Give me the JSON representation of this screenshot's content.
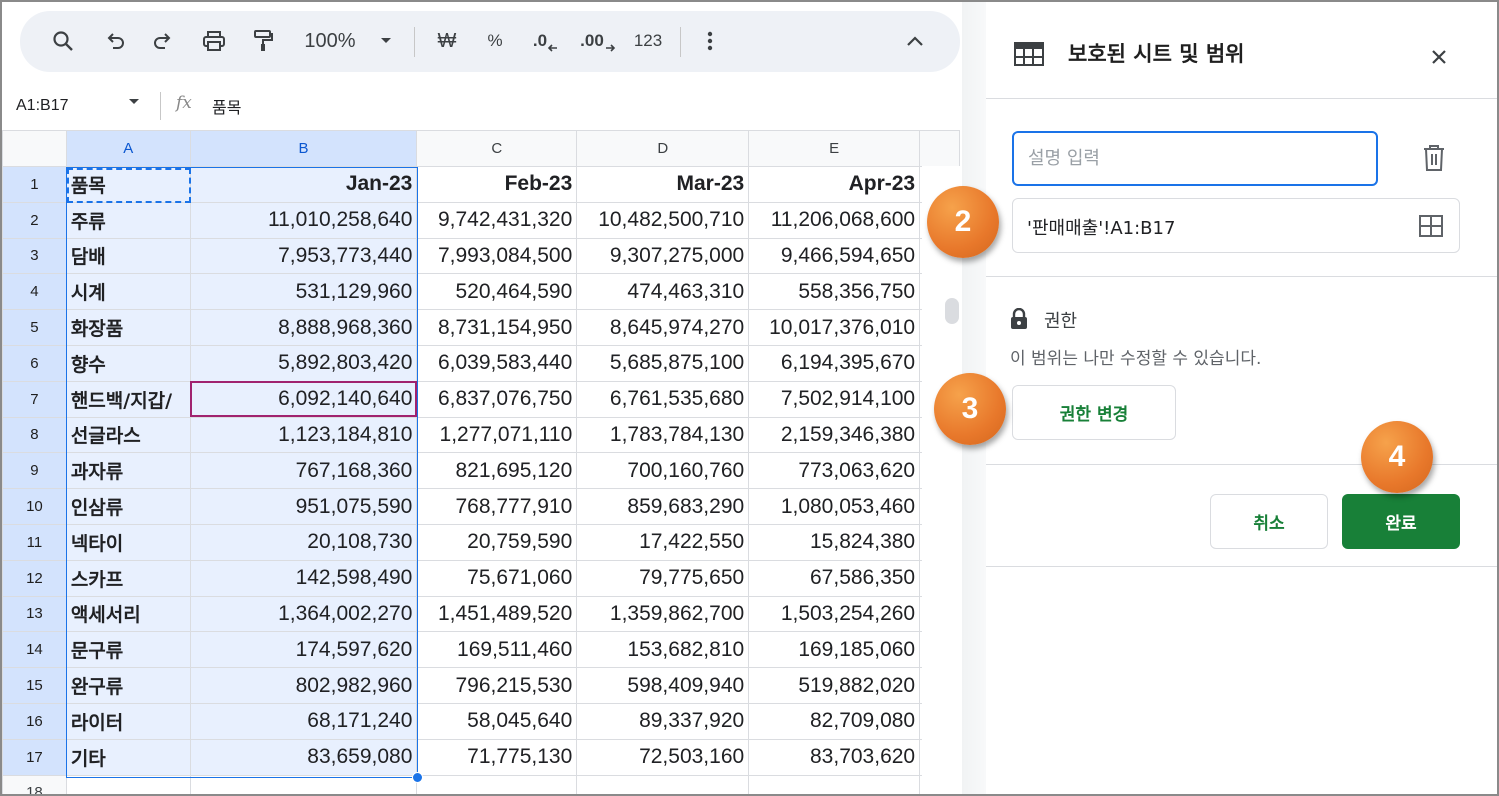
{
  "toolbar": {
    "zoom": "100%",
    "currency_symbol": "₩",
    "percent_symbol": "%",
    "decimal_decrease": ".0",
    "decimal_increase": ".00",
    "number_format": "123"
  },
  "formula_bar": {
    "name_box": "A1:B17",
    "fx": "fx",
    "content": "품목"
  },
  "sheet": {
    "columns": [
      "A",
      "B",
      "C",
      "D",
      "E"
    ],
    "rows": [
      {
        "n": "1",
        "cells": [
          "품목",
          "Jan-23",
          "Feb-23",
          "Mar-23",
          "Apr-23"
        ]
      },
      {
        "n": "2",
        "cells": [
          "주류",
          "11,010,258,640",
          "9,742,431,320",
          "10,482,500,710",
          "11,206,068,600"
        ]
      },
      {
        "n": "3",
        "cells": [
          "담배",
          "7,953,773,440",
          "7,993,084,500",
          "9,307,275,000",
          "9,466,594,650"
        ]
      },
      {
        "n": "4",
        "cells": [
          "시계",
          "531,129,960",
          "520,464,590",
          "474,463,310",
          "558,356,750"
        ]
      },
      {
        "n": "5",
        "cells": [
          "화장품",
          "8,888,968,360",
          "8,731,154,950",
          "8,645,974,270",
          "10,017,376,010"
        ]
      },
      {
        "n": "6",
        "cells": [
          "향수",
          "5,892,803,420",
          "6,039,583,440",
          "5,685,875,100",
          "6,194,395,670"
        ]
      },
      {
        "n": "7",
        "cells": [
          "핸드백/지갑/",
          "6,092,140,640",
          "6,837,076,750",
          "6,761,535,680",
          "7,502,914,100"
        ]
      },
      {
        "n": "8",
        "cells": [
          "선글라스",
          "1,123,184,810",
          "1,277,071,110",
          "1,783,784,130",
          "2,159,346,380"
        ]
      },
      {
        "n": "9",
        "cells": [
          "과자류",
          "767,168,360",
          "821,695,120",
          "700,160,760",
          "773,063,620"
        ]
      },
      {
        "n": "10",
        "cells": [
          "인삼류",
          "951,075,590",
          "768,777,910",
          "859,683,290",
          "1,080,053,460"
        ]
      },
      {
        "n": "11",
        "cells": [
          "넥타이",
          "20,108,730",
          "20,759,590",
          "17,422,550",
          "15,824,380"
        ]
      },
      {
        "n": "12",
        "cells": [
          "스카프",
          "142,598,490",
          "75,671,060",
          "79,775,650",
          "67,586,350"
        ]
      },
      {
        "n": "13",
        "cells": [
          "액세서리",
          "1,364,002,270",
          "1,451,489,520",
          "1,359,862,700",
          "1,503,254,260"
        ]
      },
      {
        "n": "14",
        "cells": [
          "문구류",
          "174,597,620",
          "169,511,460",
          "153,682,810",
          "169,185,060"
        ]
      },
      {
        "n": "15",
        "cells": [
          "완구류",
          "802,982,960",
          "796,215,530",
          "598,409,940",
          "519,882,020"
        ]
      },
      {
        "n": "16",
        "cells": [
          "라이터",
          "68,171,240",
          "58,045,640",
          "89,337,920",
          "82,709,080"
        ]
      },
      {
        "n": "17",
        "cells": [
          "기타",
          "83,659,080",
          "71,775,130",
          "72,503,160",
          "83,703,620"
        ]
      },
      {
        "n": "18",
        "cells": [
          "",
          "",
          "",
          "",
          ""
        ]
      }
    ]
  },
  "panel": {
    "title": "보호된 시트 및 범위",
    "description_placeholder": "설명 입력",
    "range": "'판매매출'!A1:B17",
    "permission_title": "권한",
    "permission_desc": "이 범위는 나만 수정할 수 있습니다.",
    "change_permission_label": "권한 변경",
    "cancel_label": "취소",
    "done_label": "완료"
  },
  "badges": {
    "step2": "2",
    "step3": "3",
    "step4": "4"
  },
  "colors": {
    "accent_green": "#188038",
    "selection_blue": "#1a73e8",
    "badge_orange": "#e8782b"
  }
}
